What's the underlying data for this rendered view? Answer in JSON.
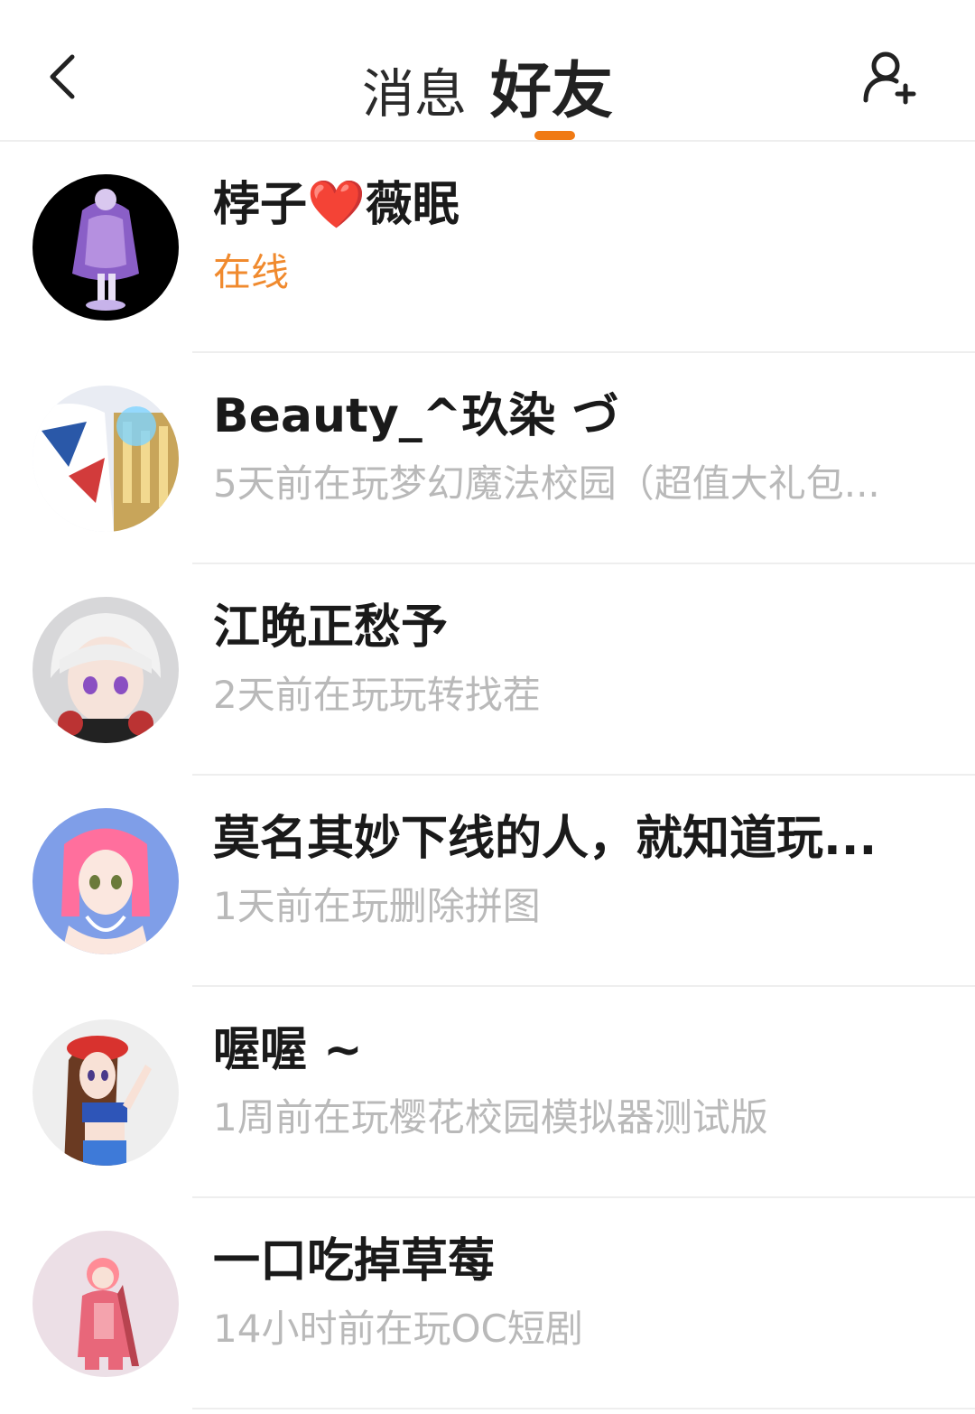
{
  "header": {
    "tab_messages": "消息",
    "tab_friends": "好友",
    "accent_color": "#f07a14"
  },
  "friends": [
    {
      "name": "桲子❤️薇眠",
      "status": "在线",
      "online": true
    },
    {
      "name": "Beauty_^玖染 づ",
      "status": "5天前在玩梦幻魔法校园（超值大礼包...",
      "online": false
    },
    {
      "name": "江晚正愁予",
      "status": "2天前在玩玩转找茬",
      "online": false
    },
    {
      "name": "莫名其妙下线的人，就知道玩...",
      "status": "1天前在玩删除拼图",
      "online": false
    },
    {
      "name": "喔喔 ~",
      "status": "1周前在玩樱花校园模拟器测试版",
      "online": false
    },
    {
      "name": "一口吃掉草莓",
      "status": "14小时前在玩OC短剧",
      "online": false
    }
  ]
}
